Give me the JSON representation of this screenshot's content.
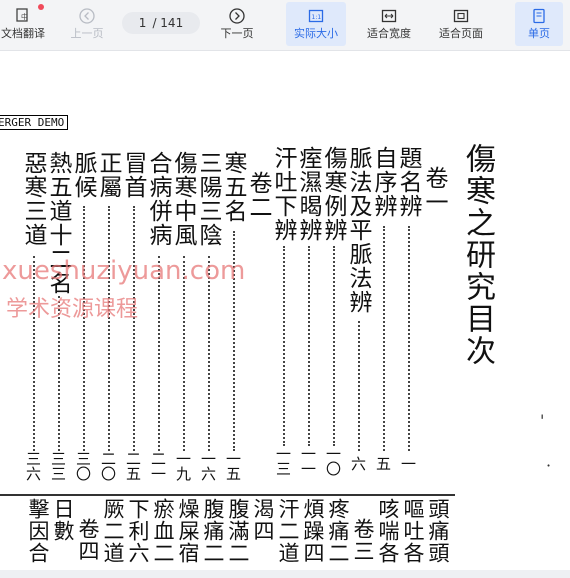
{
  "toolbar": {
    "translate": "文档翻译",
    "prev": "上一页",
    "page_current": "1",
    "page_total": "/ 141",
    "next": "下一页",
    "actual_size": "实际大小",
    "fit_width": "适合宽度",
    "fit_page": "适合页面",
    "single_page": "单页"
  },
  "doc": {
    "demo_label": "ERGER DEMO",
    "title": "傷寒之研究目次",
    "watermark_url": "xueshuziyuan.com",
    "watermark_cn": "学术资源课程",
    "columns": [
      {
        "text": "卷一",
        "page": ""
      },
      {
        "text": "題名辨",
        "page": "一"
      },
      {
        "text": "自序辨",
        "page": "五"
      },
      {
        "text": "脈法及平脈法辨",
        "page": "六"
      },
      {
        "text": "傷寒例辨",
        "page": "一〇"
      },
      {
        "text": "痓濕暍辨",
        "page": "一一"
      },
      {
        "text": "汗吐下辨",
        "page": "一三"
      },
      {
        "text": "卷二",
        "page": ""
      },
      {
        "text": "寒五名",
        "page": "一五"
      },
      {
        "text": "三陽三陰",
        "page": "一六"
      },
      {
        "text": "傷寒中風",
        "page": "一九"
      },
      {
        "text": "合病併病",
        "page": "二一"
      },
      {
        "text": "冒首",
        "page": "二五"
      },
      {
        "text": "正屬",
        "page": "二〇"
      },
      {
        "text": "脈候",
        "page": "三〇"
      },
      {
        "text": "熱五道十二名",
        "page": "三三"
      },
      {
        "text": "惡寒三道",
        "page": "三六"
      }
    ],
    "bottom": [
      "頭痛頭",
      "嘔吐各",
      "咳喘各",
      "卷三",
      "疼痛二",
      "煩躁四",
      "汗二道",
      "渴四",
      "腹滿二",
      "腹痛二",
      "燥屎宿",
      "瘀血二",
      "下利六",
      "厥二道",
      "卷四",
      "日數",
      "擊因合"
    ]
  }
}
